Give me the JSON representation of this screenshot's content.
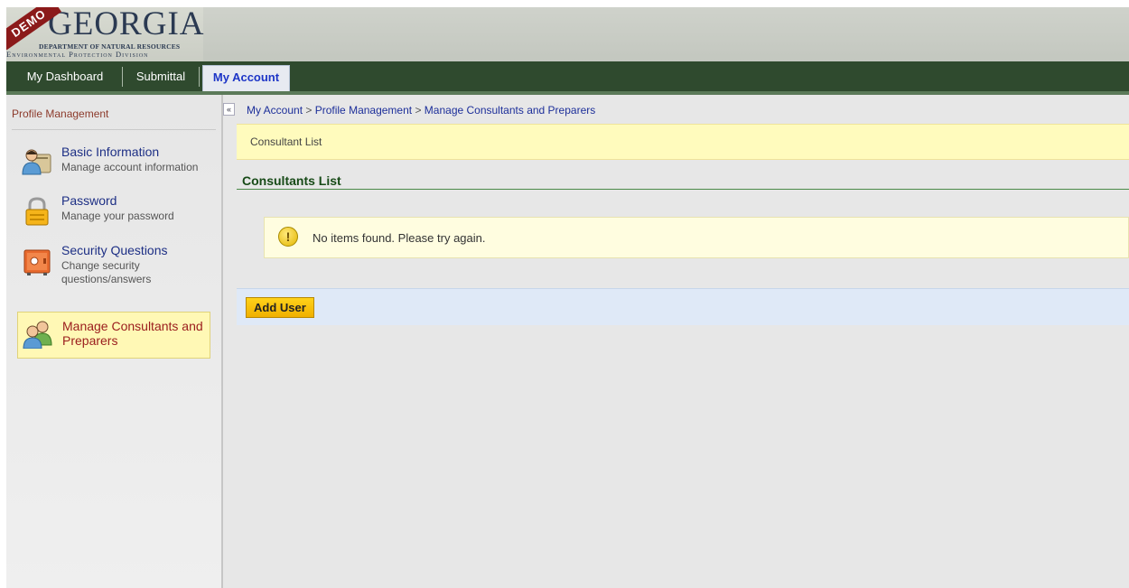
{
  "header": {
    "demo_ribbon": "DEMO",
    "logo_title": "GEORGIA",
    "logo_department": "DEPARTMENT OF NATURAL RESOURCES",
    "logo_division": "Environmental Protection Division"
  },
  "nav": {
    "tabs": [
      {
        "label": "My Dashboard"
      },
      {
        "label": "Submittal"
      },
      {
        "label": "My Account"
      }
    ],
    "active_tab": "My Account"
  },
  "sidebar": {
    "title": "Profile Management",
    "items": [
      {
        "label": "Basic Information",
        "description": "Manage account information",
        "icon": "user-card-icon"
      },
      {
        "label": "Password",
        "description": "Manage your password",
        "icon": "padlock-icon"
      },
      {
        "label": "Security Questions",
        "description": "Change security questions/answers",
        "icon": "safe-icon"
      },
      {
        "label": "Manage Consultants and Preparers",
        "description": "",
        "icon": "users-icon"
      }
    ],
    "active_item": "Manage Consultants and Preparers",
    "collapse_glyph": "«"
  },
  "breadcrumb": {
    "items": [
      "My Account",
      "Profile Management",
      "Manage Consultants and Preparers"
    ],
    "separator": ">"
  },
  "main": {
    "section_label": "Consultant List",
    "list_heading": "Consultants List",
    "empty_message": "No items found. Please try again.",
    "warning_glyph": "!",
    "add_button_label": "Add User"
  },
  "colors": {
    "nav_bg": "#2f4a2e",
    "active_tab_text": "#1d35c7",
    "highlight_yellow": "#fffbbd",
    "button_yellow": "#ffd21a",
    "action_bar_blue": "#dfe9f7",
    "demo_ribbon": "#8b1a1a"
  }
}
